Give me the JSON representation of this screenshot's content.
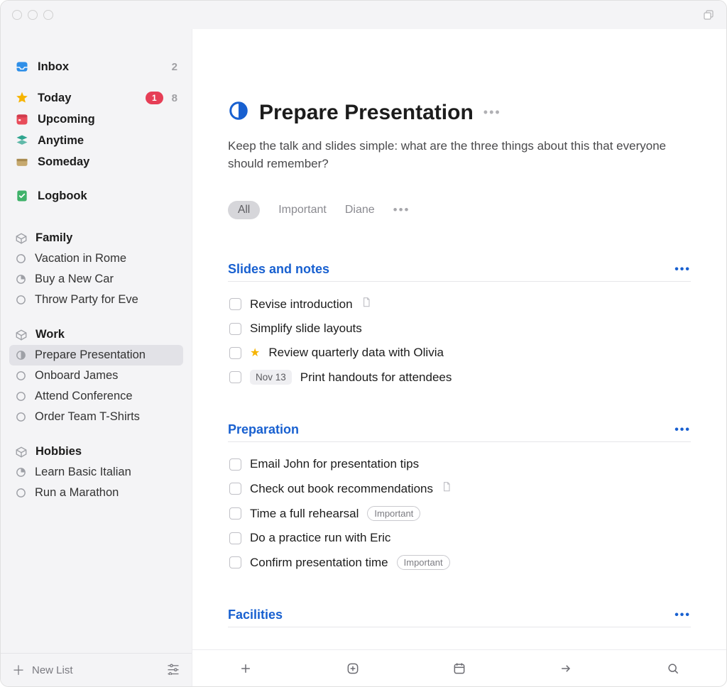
{
  "sidebar": {
    "inbox": {
      "label": "Inbox",
      "count": "2"
    },
    "today": {
      "label": "Today",
      "badge": "1",
      "count": "8"
    },
    "upcoming": {
      "label": "Upcoming"
    },
    "anytime": {
      "label": "Anytime"
    },
    "someday": {
      "label": "Someday"
    },
    "logbook": {
      "label": "Logbook"
    },
    "areas": [
      {
        "name": "Family",
        "projects": [
          {
            "label": "Vacation in Rome"
          },
          {
            "label": "Buy a New Car"
          },
          {
            "label": "Throw Party for Eve"
          }
        ]
      },
      {
        "name": "Work",
        "projects": [
          {
            "label": "Prepare Presentation",
            "selected": true
          },
          {
            "label": "Onboard James"
          },
          {
            "label": "Attend Conference"
          },
          {
            "label": "Order Team T-Shirts"
          }
        ]
      },
      {
        "name": "Hobbies",
        "projects": [
          {
            "label": "Learn Basic Italian"
          },
          {
            "label": "Run a Marathon"
          }
        ]
      }
    ],
    "new_list_label": "New List"
  },
  "main": {
    "title": "Prepare Presentation",
    "notes": "Keep the talk and slides simple: what are the three things about this that everyone should remember?",
    "tags": {
      "all": "All",
      "t1": "Important",
      "t2": "Diane"
    },
    "headings": [
      {
        "title": "Slides and notes",
        "tasks": [
          {
            "title": "Revise introduction",
            "has_note": true
          },
          {
            "title": "Simplify slide layouts"
          },
          {
            "title": "Review quarterly data with Olivia",
            "starred": true
          },
          {
            "title": "Print handouts for attendees",
            "date": "Nov 13"
          }
        ]
      },
      {
        "title": "Preparation",
        "tasks": [
          {
            "title": "Email John for presentation tips"
          },
          {
            "title": "Check out book recommendations",
            "has_note": true
          },
          {
            "title": "Time a full rehearsal",
            "tag": "Important"
          },
          {
            "title": "Do a practice run with Eric"
          },
          {
            "title": "Confirm presentation time",
            "tag": "Important"
          }
        ]
      },
      {
        "title": "Facilities",
        "tasks": []
      }
    ]
  },
  "colors": {
    "blue": "#1860d0",
    "inboxBlue": "#2f8fe8",
    "todayStar": "#f6b400",
    "upcomingRed": "#e84c5a",
    "anytimeTeal": "#2fa58f",
    "somedayTan": "#c6a96f",
    "logbookGreen": "#3fb26a"
  }
}
